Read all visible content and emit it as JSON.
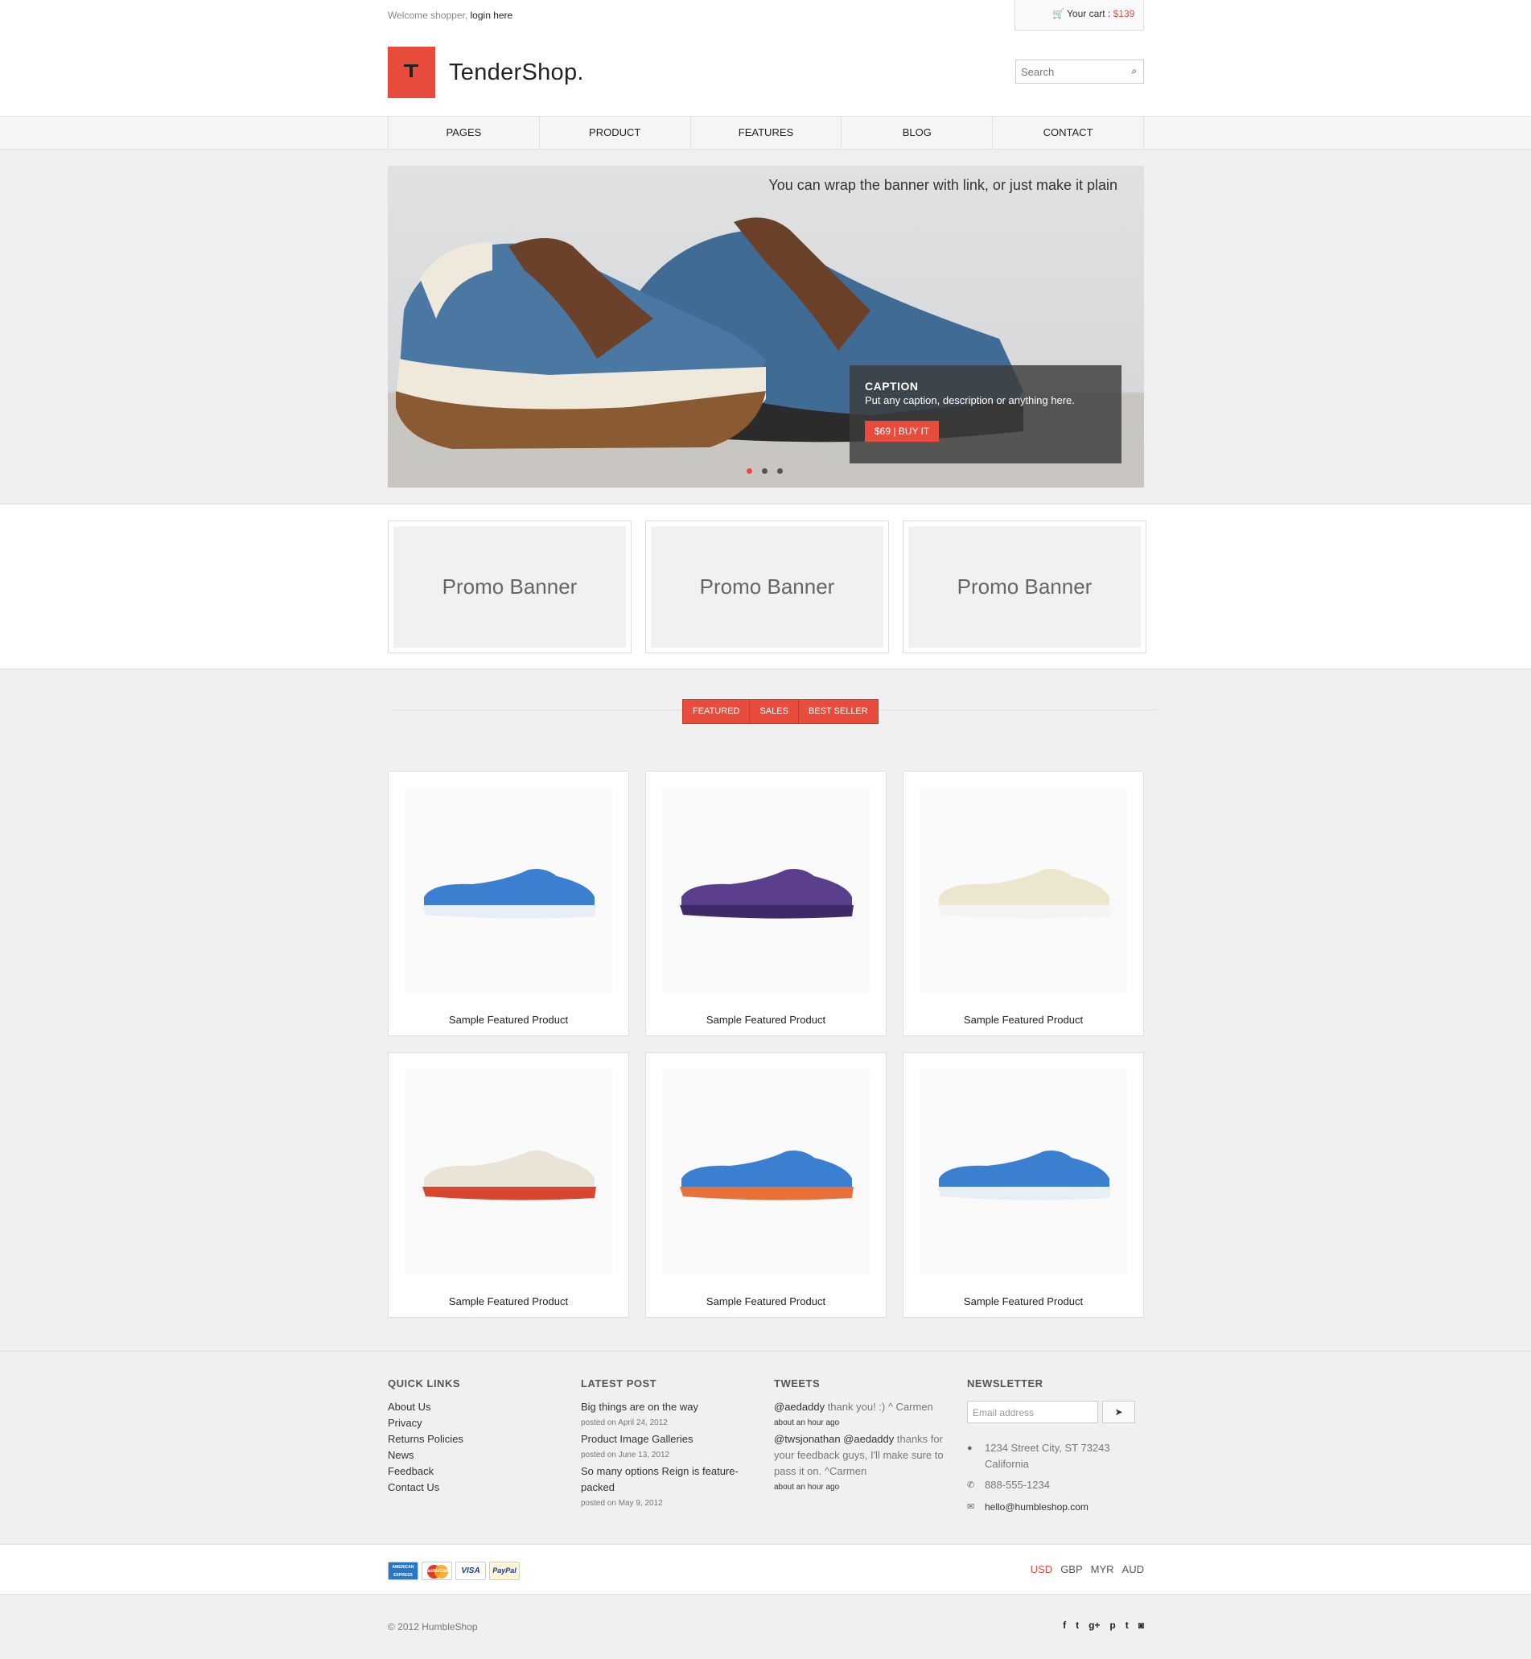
{
  "topbar": {
    "welcome_text": "Welcome shopper,",
    "login_link": "login here",
    "cart_label": "Your cart :",
    "cart_total": "$139"
  },
  "header": {
    "brand": "TenderShop.",
    "search_placeholder": "Search"
  },
  "nav": {
    "items": [
      {
        "label": "PAGES"
      },
      {
        "label": "PRODUCT"
      },
      {
        "label": "FEATURES"
      },
      {
        "label": "BLOG"
      },
      {
        "label": "CONTACT"
      }
    ]
  },
  "hero": {
    "headline": "You can wrap the banner with link, or just  make it plain",
    "caption_title": "CAPTION",
    "caption_desc": "Put any caption, description or anything here.",
    "buy_label": "$69 | BUY IT",
    "slide_count": 3,
    "active_slide": 1
  },
  "promos": [
    {
      "label": "Promo Banner"
    },
    {
      "label": "Promo Banner"
    },
    {
      "label": "Promo Banner"
    }
  ],
  "product_tabs": [
    {
      "label": "FEATURED"
    },
    {
      "label": "SALES"
    },
    {
      "label": "BEST SELLER"
    }
  ],
  "products": [
    {
      "name": "Sample Featured Product",
      "color": "#3a7fd0",
      "sole": "#e8eef5"
    },
    {
      "name": "Sample Featured Product",
      "color": "#5b3f8c",
      "sole": "#3e2a66"
    },
    {
      "name": "Sample Featured Product",
      "color": "#ede6cf",
      "sole": "#f4f4f4"
    },
    {
      "name": "Sample Featured Product",
      "color": "#e9e4d6",
      "sole": "#d9462f"
    },
    {
      "name": "Sample Featured Product",
      "color": "#3a7fd0",
      "sole": "#e8713a"
    },
    {
      "name": "Sample Featured Product",
      "color": "#3a7fd0",
      "sole": "#e8eef5"
    }
  ],
  "footer": {
    "quick_links_title": "QUICK LINKS",
    "quick_links": [
      "About Us",
      "Privacy",
      "Returns Policies",
      "News",
      "Feedback",
      "Contact Us"
    ],
    "latest_post_title": "LATEST POST",
    "posts": [
      {
        "title": "Big things are on the way",
        "date": "posted on April 24, 2012"
      },
      {
        "title": "Product Image Galleries",
        "date": "posted on June 13, 2012"
      },
      {
        "title": "So many options Reign is feature-packed",
        "date": "posted on May 9, 2012"
      }
    ],
    "tweets_title": "TWEETS",
    "tweets": [
      {
        "user": "@aedaddy",
        "text": " thank you! :) ^ Carmen",
        "time": "about an hour ago"
      },
      {
        "user": "@twsjonathan @aedaddy",
        "text": " thanks for your feedback guys, I'll make sure to pass it on. ^Carmen",
        "time": "about an hour ago"
      }
    ],
    "newsletter_title": "NEWSLETTER",
    "email_placeholder": "Email address",
    "address": "1234 Street City, ST 73243 California",
    "phone": "888-555-1234",
    "email": "hello@humbleshop.com"
  },
  "payments": {
    "cards": [
      {
        "label": "AMERICAN EXPRESS"
      },
      {
        "label": "MasterCard"
      },
      {
        "label": "VISA"
      },
      {
        "label": "PayPal"
      }
    ],
    "currencies": [
      "USD",
      "GBP",
      "MYR",
      "AUD"
    ],
    "active_currency": "USD"
  },
  "bottom": {
    "copyright": "© 2012 HumbleShop",
    "social": [
      {
        "icon": "facebook-icon",
        "glyph": "f"
      },
      {
        "icon": "twitter-icon",
        "glyph": "t"
      },
      {
        "icon": "google-plus-icon",
        "glyph": "g+"
      },
      {
        "icon": "pinterest-icon",
        "glyph": "p"
      },
      {
        "icon": "tumblr-icon",
        "glyph": "t"
      },
      {
        "icon": "instagram-icon",
        "glyph": "◙"
      }
    ]
  }
}
